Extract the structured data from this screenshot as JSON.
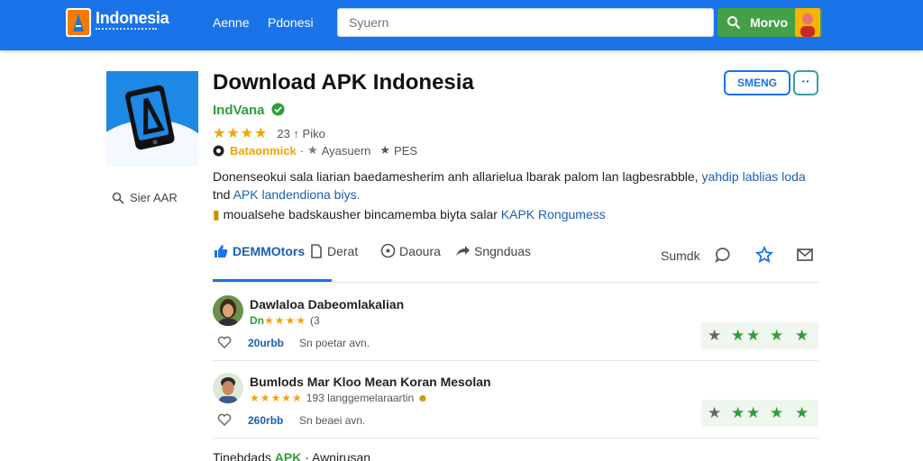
{
  "header": {
    "brand": "Indonesia",
    "nav": [
      "Aenne",
      "Pdonesi"
    ],
    "search_placeholder": "Syuern",
    "search_button": "Morvo"
  },
  "app": {
    "title": "Download APK Indonesia",
    "developer": "IndVana",
    "rating_stars": "★★★★",
    "rating_text": "23 ↑ Piko",
    "category": "Bataonmick",
    "meta_1": "Ayasuern",
    "meta_2": "PES",
    "description_1": "Donenseokui sala liarian baedamesherim anh allarielua lbarak palom lan lagbesrabble,",
    "description_1_link": "yahdip lablias loda",
    "description_2": "tnd",
    "description_2_link": "APK landendiona biys.",
    "note_text": "moualsehe badskausher bincamemba biyta salar",
    "note_link": "KAPK Rongumess",
    "install_label": "SMENG",
    "more_label": "··",
    "sidebar_search": "Sier AAR"
  },
  "tabs": [
    {
      "label": "DEMMOtors",
      "active": true
    },
    {
      "label": "Derat"
    },
    {
      "label": "Daoura"
    },
    {
      "label": "Sngnduas"
    }
  ],
  "sort_label": "Sumdk",
  "reviews": [
    {
      "name": "Dawlaloa Dabeomlakalian",
      "sub_prefix": "Dn",
      "stars": "★★★★",
      "sub_text": "(3",
      "likes": "20urbb",
      "reply": "Sn poetar avn."
    },
    {
      "name": "Bumlods Mar Kloo Mean Koran Mesolan",
      "stars": "★★★★★",
      "sub_text": "193 langgemelaraartin",
      "likes": "260rbb",
      "reply": "Sn beaei avn."
    }
  ],
  "footer": {
    "prefix": "Tinebdads",
    "tag": "APK",
    "suffix": "· Awnirusan"
  },
  "colors": {
    "header_blue": "#1a73e8",
    "accent_green": "#43a047",
    "star_orange": "#f4a300"
  }
}
